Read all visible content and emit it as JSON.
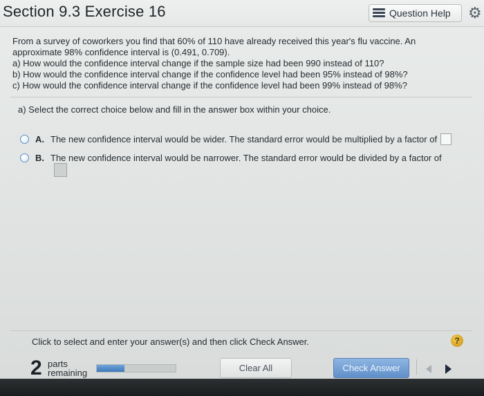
{
  "header": {
    "title": "Section 9.3 Exercise 16",
    "help_label": "Question Help"
  },
  "question": {
    "lines": [
      "From a survey of coworkers you find that 60% of 110 have already received this year's flu vaccine. An",
      "approximate 98% confidence interval is (0.491, 0.709).",
      "a) How would the confidence interval change if the sample size had been 990 instead of 110?",
      "b) How would the confidence interval change if the confidence level had been 95% instead of 98%?",
      "c) How would the confidence interval change if the confidence level had been 99% instead of 98%?"
    ]
  },
  "instruction": "a) Select the correct choice below and fill in the answer box within your choice.",
  "choices": [
    {
      "letter": "A.",
      "text": "The new confidence interval would be wider. The standard error would be multiplied by a factor of"
    },
    {
      "letter": "B.",
      "text": "The new confidence interval would be narrower. The standard error would be divided by a factor of"
    }
  ],
  "footer": {
    "message": "Click to select and enter your answer(s) and then click Check Answer.",
    "help_badge": "?",
    "parts_count": "2",
    "parts_word": "parts",
    "remaining_word": "remaining",
    "progress_fraction": 0.35,
    "clear_label": "Clear All",
    "check_label": "Check Answer"
  },
  "colors": {
    "accent": "#5f8fc9",
    "progress": "#3f79bb",
    "badge": "#d9a62a"
  }
}
